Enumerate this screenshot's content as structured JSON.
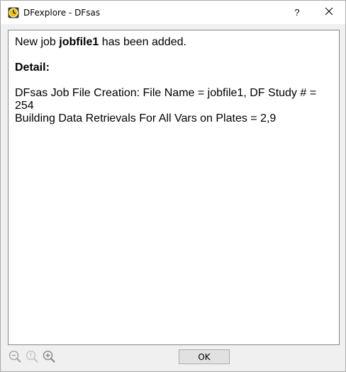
{
  "window": {
    "title": "DFexplore - DFsas",
    "help_label": "?",
    "close_label": "✕"
  },
  "message": {
    "line1_prefix": "New job ",
    "line1_bold": "jobfile1",
    "line1_suffix": " has been added.",
    "detail_heading": "Detail:",
    "detail_line1": "DFsas Job File Creation: File Name = jobfile1, DF Study # = 254",
    "detail_line2": "Building Data Retrievals For All Vars on Plates = 2,9"
  },
  "toolbar": {
    "zoom_out_icon": "zoom-out-icon",
    "zoom_reset_icon": "zoom-reset-icon",
    "zoom_in_icon": "zoom-in-icon",
    "ok_label": "OK"
  },
  "colors": {
    "accent": "#f2c200",
    "disabled_icon": "#a0a0a0"
  }
}
